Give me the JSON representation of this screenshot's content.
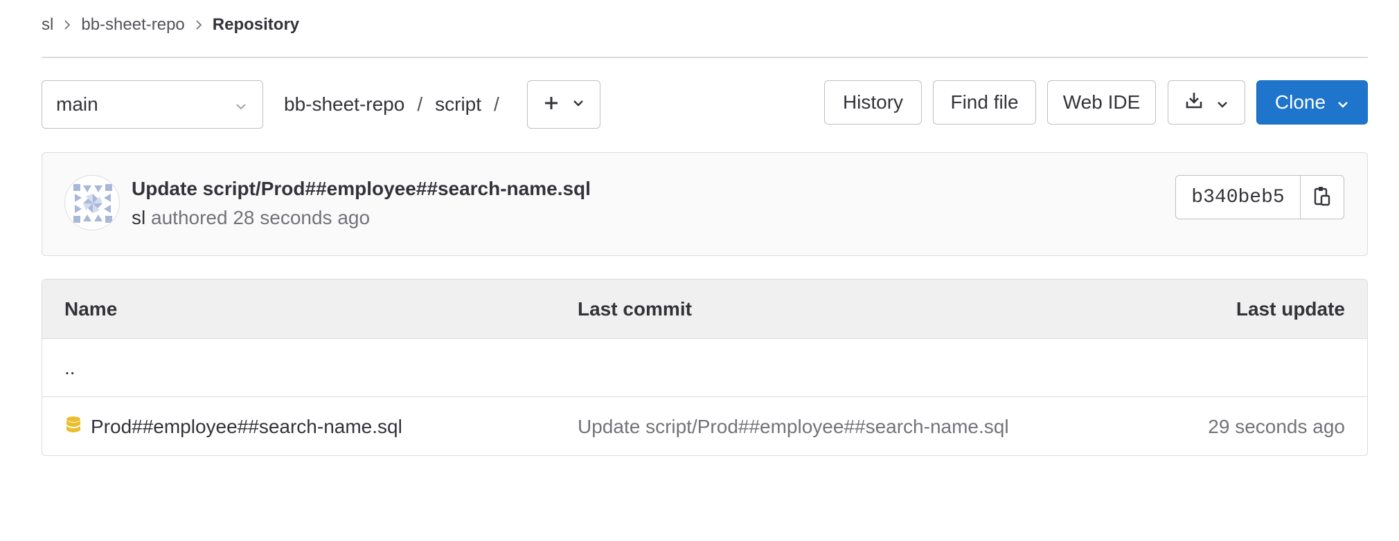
{
  "breadcrumb": {
    "items": [
      "sl",
      "bb-sheet-repo"
    ],
    "current": "Repository"
  },
  "toolbar": {
    "branch": "main",
    "path": [
      "bb-sheet-repo",
      "script"
    ],
    "path_separator": "/",
    "buttons": {
      "history": "History",
      "find_file": "Find file",
      "web_ide": "Web IDE",
      "clone": "Clone"
    }
  },
  "commit": {
    "title": "Update script/Prod##employee##search-name.sql",
    "author": "sl",
    "meta": "authored 28 seconds ago",
    "sha": "b340beb5"
  },
  "table": {
    "headers": {
      "name": "Name",
      "last_commit": "Last commit",
      "last_update": "Last update"
    },
    "parent_dir": "..",
    "rows": [
      {
        "name": "Prod##employee##search-name.sql",
        "icon": "database-icon",
        "last_commit": "Update script/Prod##employee##search-name.sql",
        "last_update": "29 seconds ago"
      }
    ]
  },
  "colors": {
    "primary": "#1f75cb",
    "border": "#dcdcde",
    "text": "#333238",
    "muted": "#737278",
    "sql_icon": "#e9be2f"
  }
}
